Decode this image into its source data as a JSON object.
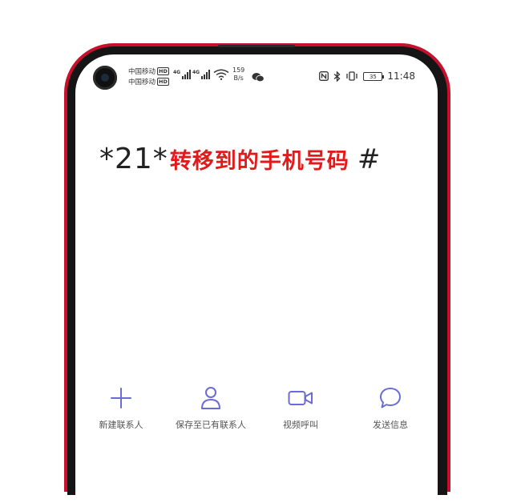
{
  "status_bar": {
    "carrier_1": "中国移动",
    "carrier_2": "中国移动",
    "hd_badge": "HD",
    "network_1": "4G",
    "network_2": "4G",
    "net_speed_value": "159",
    "net_speed_unit": "B/s",
    "battery_level": "35",
    "time": "11:48",
    "icons": [
      "camera-hole",
      "signal-icon",
      "wifi-icon",
      "wechat-icon",
      "nfc-icon",
      "bluetooth-icon",
      "vibrate-icon",
      "battery-icon"
    ]
  },
  "dial_code": {
    "prefix": "*21*",
    "middle": "转移到的手机号码",
    "suffix": "#"
  },
  "actions": [
    {
      "label": "新建联系人",
      "icon": "plus-icon"
    },
    {
      "label": "保存至已有联系人",
      "icon": "person-icon"
    },
    {
      "label": "视频呼叫",
      "icon": "video-camera-icon"
    },
    {
      "label": "发送信息",
      "icon": "message-icon"
    }
  ],
  "colors": {
    "phone_frame": "#c7102e",
    "accent_icons": "#6b6bd6",
    "code_highlight": "#e11b1b"
  }
}
